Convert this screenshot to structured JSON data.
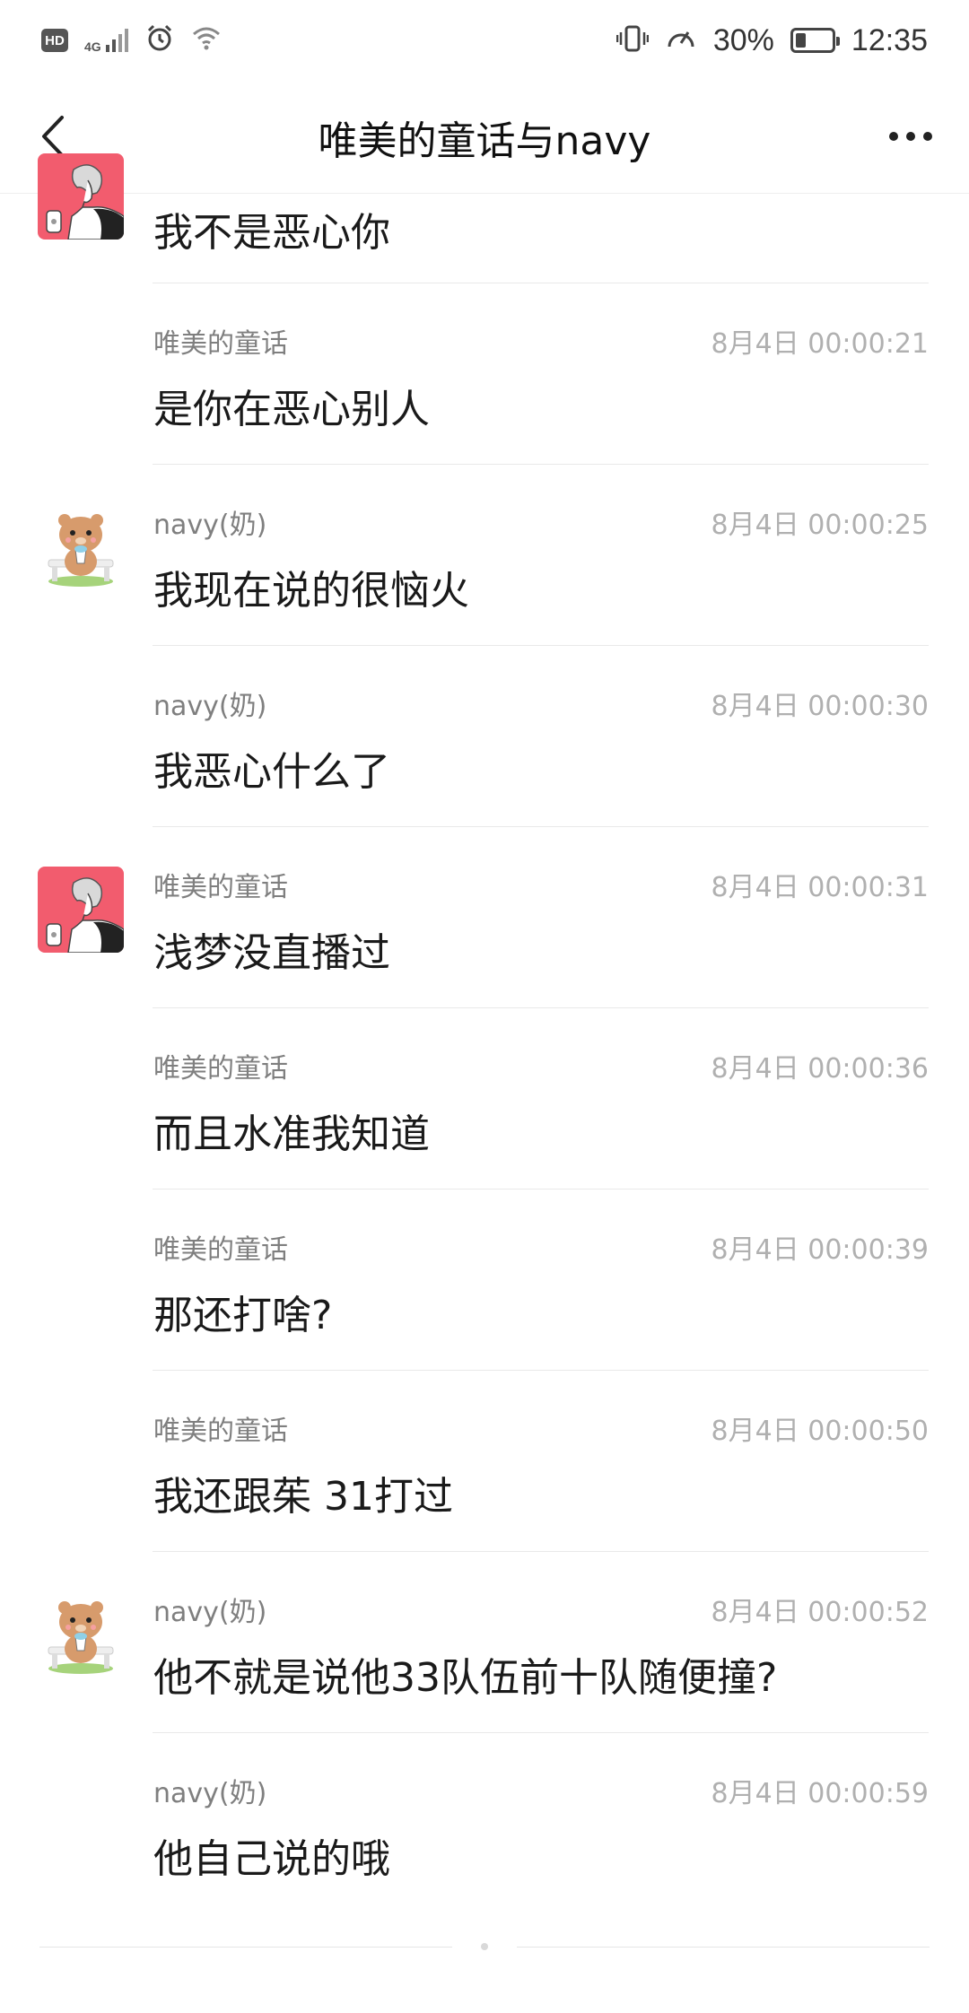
{
  "status_bar": {
    "hd": "HD",
    "network": "4G",
    "battery_percent": "30%",
    "time": "12:35",
    "battery_level": 0.3
  },
  "header": {
    "title": "唯美的童话与navy"
  },
  "messages": [
    {
      "name": "",
      "time": "",
      "content": "我不是恶心你",
      "avatar": "girl"
    },
    {
      "name": "唯美的童话",
      "time": "8月4日 00:00:21",
      "content": "是你在恶心别人",
      "avatar": ""
    },
    {
      "name": "navy(奶)",
      "time": "8月4日 00:00:25",
      "content": "我现在说的很恼火",
      "avatar": "bear"
    },
    {
      "name": "navy(奶)",
      "time": "8月4日 00:00:30",
      "content": "我恶心什么了",
      "avatar": ""
    },
    {
      "name": "唯美的童话",
      "time": "8月4日 00:00:31",
      "content": "浅梦没直播过",
      "avatar": "girl"
    },
    {
      "name": "唯美的童话",
      "time": "8月4日 00:00:36",
      "content": "而且水准我知道",
      "avatar": ""
    },
    {
      "name": "唯美的童话",
      "time": "8月4日 00:00:39",
      "content": "那还打啥?",
      "avatar": ""
    },
    {
      "name": "唯美的童话",
      "time": "8月4日 00:00:50",
      "content": "我还跟茱 31打过",
      "avatar": ""
    },
    {
      "name": "navy(奶)",
      "time": "8月4日 00:00:52",
      "content": "他不就是说他33队伍前十队随便撞?",
      "avatar": "bear"
    },
    {
      "name": "navy(奶)",
      "time": "8月4日 00:00:59",
      "content": "他自己说的哦",
      "avatar": ""
    }
  ],
  "colors": {
    "girl_avatar_bg": "#f25c6e",
    "bear_body": "#d79b6c",
    "grass": "#a6d37b"
  }
}
